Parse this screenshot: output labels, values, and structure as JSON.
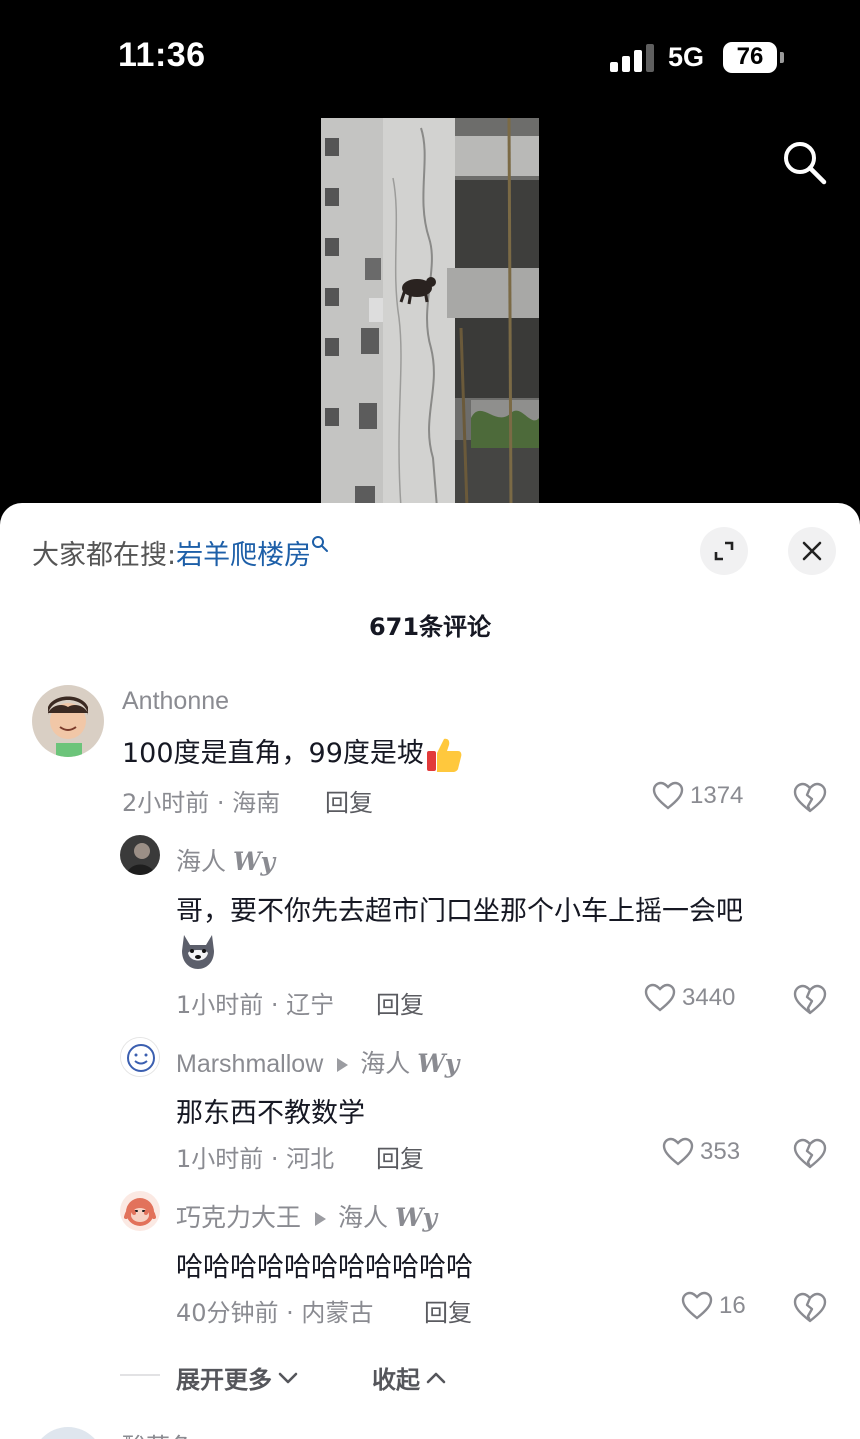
{
  "status_bar": {
    "time": "11:36",
    "network": "5G",
    "battery": "76"
  },
  "hot_search": {
    "prefix": "大家都在搜:",
    "keyword": "岩羊爬楼房"
  },
  "comments_count": "671条评论",
  "comments": [
    {
      "user": "Anthonne",
      "text": "100度是直角，99度是坡",
      "emoji": "thumbs-up",
      "time": "2小时前 · 海南",
      "reply_label": "回复",
      "likes": "1374"
    }
  ],
  "replies": [
    {
      "user": "海人",
      "user_sig": "Wy",
      "text": "哥，要不你先去超市门口坐那个小车上摇一会吧",
      "emoji": "husky-dog",
      "time": "1小时前 · 辽宁",
      "reply_label": "回复",
      "likes": "3440"
    },
    {
      "user": "Marshmallow",
      "reply_to": "海人",
      "reply_to_sig": "Wy",
      "text": "那东西不教数学",
      "time": "1小时前 · 河北",
      "reply_label": "回复",
      "likes": "353"
    },
    {
      "user": "巧克力大王",
      "reply_to": "海人",
      "reply_to_sig": "Wy",
      "text": "哈哈哈哈哈哈哈哈哈哈哈",
      "time": "40分钟前 · 内蒙古",
      "reply_label": "回复",
      "likes": "16"
    }
  ],
  "fold": {
    "expand": "展开更多",
    "collapse": "收起"
  },
  "next_comment_user": "酸菜鱼",
  "icons": {
    "search": "search-icon",
    "expand": "expand-icon",
    "close": "close-icon",
    "like": "heart-icon",
    "dislike": "broken-heart-icon"
  }
}
